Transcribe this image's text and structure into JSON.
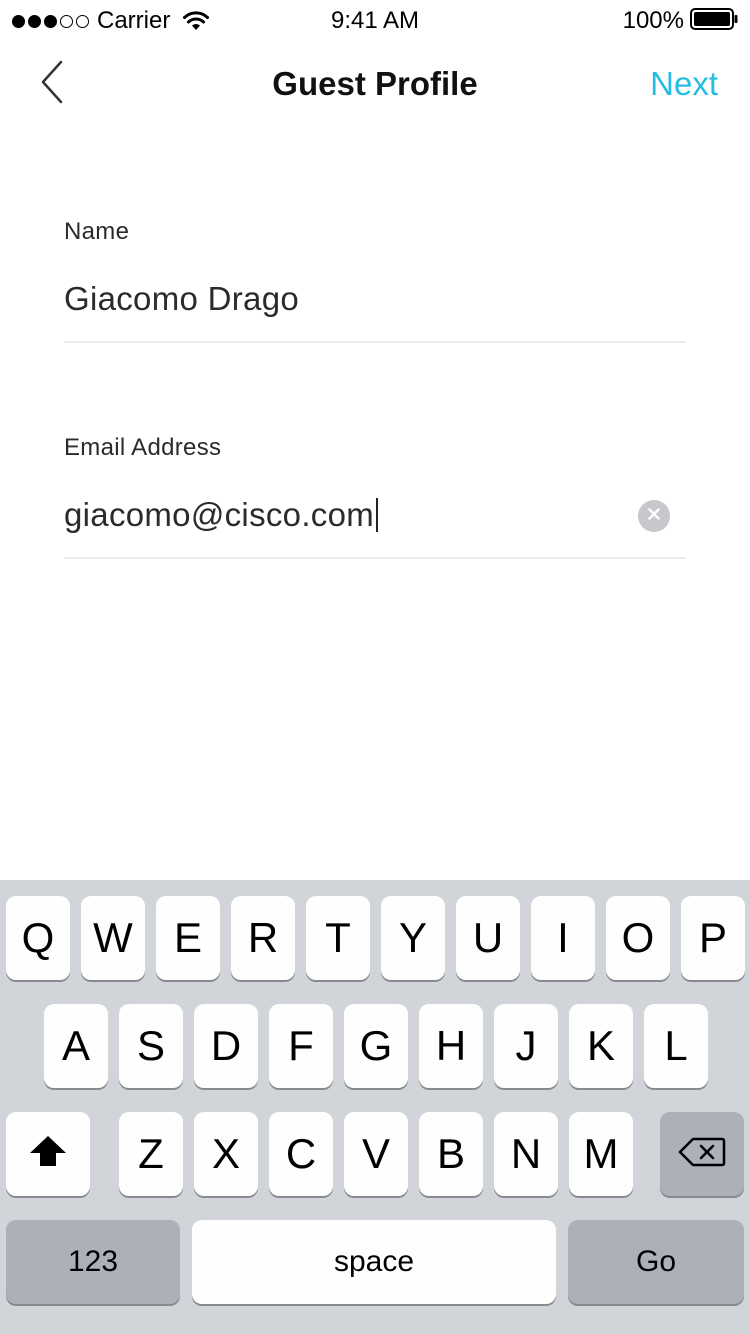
{
  "status_bar": {
    "carrier": "Carrier",
    "time": "9:41 AM",
    "battery": "100%",
    "signal_filled": 3,
    "signal_total": 5
  },
  "nav": {
    "title": "Guest Profile",
    "next_label": "Next",
    "back_icon": "chevron-left-icon",
    "accent_color": "#27bde3"
  },
  "form": {
    "name_label": "Name",
    "name_value": "Giacomo Drago",
    "email_label": "Email Address",
    "email_value": "giacomo@cisco.com"
  },
  "keyboard": {
    "row1": [
      "Q",
      "W",
      "E",
      "R",
      "T",
      "Y",
      "U",
      "I",
      "O",
      "P"
    ],
    "row2": [
      "A",
      "S",
      "D",
      "F",
      "G",
      "H",
      "J",
      "K",
      "L"
    ],
    "row3": [
      "Z",
      "X",
      "C",
      "V",
      "B",
      "N",
      "M"
    ],
    "numbers_label": "123",
    "space_label": "space",
    "go_label": "Go",
    "shift_icon": "shift-icon",
    "delete_icon": "backspace-icon"
  }
}
